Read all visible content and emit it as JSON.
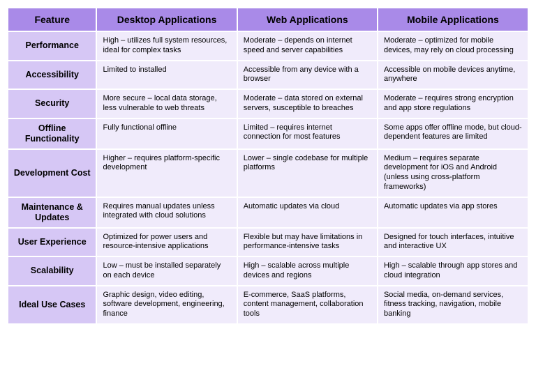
{
  "headers": [
    "Feature",
    "Desktop Applications",
    "Web Applications",
    "Mobile Applications"
  ],
  "rows": [
    {
      "feature": "Performance",
      "desktop": "High – utilizes full system resources, ideal for complex tasks",
      "web": "Moderate – depends on internet speed and server capabilities",
      "mobile": "Moderate – optimized for mobile devices, may rely on cloud processing"
    },
    {
      "feature": "Accessibility",
      "desktop": "Limited to installed",
      "web": "Accessible from any device with a  browser",
      "mobile": "Accessible on mobile devices anytime, anywhere"
    },
    {
      "feature": "Security",
      "desktop": "More secure – local data storage, less vulnerable to web threats",
      "web": "Moderate – data stored on external servers, susceptible to breaches",
      "mobile": "Moderate – requires strong encryption and app store regulations"
    },
    {
      "feature": "Offline Functionality",
      "desktop": "Fully functional offline",
      "web": "Limited – requires internet connection for most features",
      "mobile": "Some apps offer offline mode, but cloud-dependent features are limited"
    },
    {
      "feature": "Development Cost",
      "desktop": "Higher – requires platform-specific development",
      "web": "Lower – single codebase for multiple platforms",
      "mobile": "Medium – requires separate development for iOS and Android (unless using cross-platform frameworks)"
    },
    {
      "feature": "Maintenance & Updates",
      "desktop": "Requires manual updates unless integrated with cloud solutions",
      "web": "Automatic updates via cloud",
      "mobile": "Automatic updates via app stores"
    },
    {
      "feature": "User Experience",
      "desktop": "Optimized for power users and resource-intensive applications",
      "web": "Flexible but may have limitations in performance-intensive tasks",
      "mobile": "Designed for touch interfaces, intuitive and interactive UX"
    },
    {
      "feature": "Scalability",
      "desktop": "Low – must be installed separately on each device",
      "web": "High – scalable across multiple devices and regions",
      "mobile": "High – scalable through app stores and cloud integration"
    },
    {
      "feature": "Ideal Use Cases",
      "desktop": "Graphic design, video editing, software development, engineering, finance",
      "web": "E-commerce, SaaS platforms, content management, collaboration tools",
      "mobile": "Social media, on-demand services, fitness tracking, navigation, mobile banking"
    }
  ]
}
